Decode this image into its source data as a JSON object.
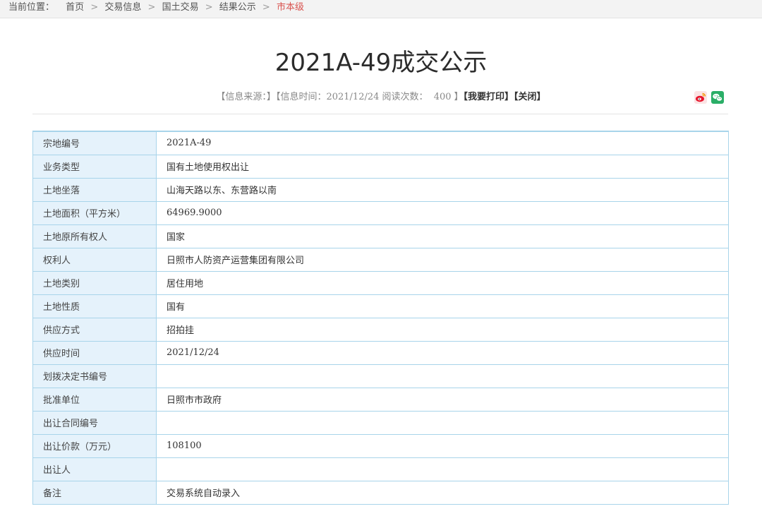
{
  "breadcrumb": {
    "prefix": "当前位置：",
    "items": [
      "首页",
      "交易信息",
      "国土交易",
      "结果公示"
    ],
    "current": "市本级",
    "separator": ">"
  },
  "title": "2021A-49成交公示",
  "meta": {
    "source_label": "【信息来源：】",
    "time_label": "【信息时间：",
    "time_value": "2021/12/24",
    "read_label": "阅读次数：",
    "read_count": "400",
    "read_close": "】",
    "print_label": "【我要打印】",
    "close_label": "【关闭】"
  },
  "share": {
    "icons": [
      "weibo-icon",
      "wechat-icon"
    ],
    "weibo_color": "#e6162d",
    "wechat_color": "#2aae67"
  },
  "table": {
    "rows": [
      {
        "label": "宗地编号",
        "value": "2021A-49"
      },
      {
        "label": "业务类型",
        "value": "国有土地使用权出让"
      },
      {
        "label": "土地坐落",
        "value": "山海天路以东、东营路以南"
      },
      {
        "label": "土地面积（平方米）",
        "value": "64969.9000"
      },
      {
        "label": "土地原所有权人",
        "value": "国家"
      },
      {
        "label": "权利人",
        "value": "日照市人防资产运营集团有限公司"
      },
      {
        "label": "土地类别",
        "value": "居住用地"
      },
      {
        "label": "土地性质",
        "value": "国有"
      },
      {
        "label": "供应方式",
        "value": "招拍挂"
      },
      {
        "label": "供应时间",
        "value": "2021/12/24"
      },
      {
        "label": "划拨决定书编号",
        "value": ""
      },
      {
        "label": "批准单位",
        "value": "日照市市政府"
      },
      {
        "label": "出让合同编号",
        "value": ""
      },
      {
        "label": "出让价款（万元）",
        "value": "108100"
      },
      {
        "label": "出让人",
        "value": ""
      },
      {
        "label": "备注",
        "value": "交易系统自动录入"
      }
    ]
  },
  "colors": {
    "border": "#a8d4ea",
    "label_bg": "#e5f2fb",
    "current_crumb": "#d9534f"
  }
}
